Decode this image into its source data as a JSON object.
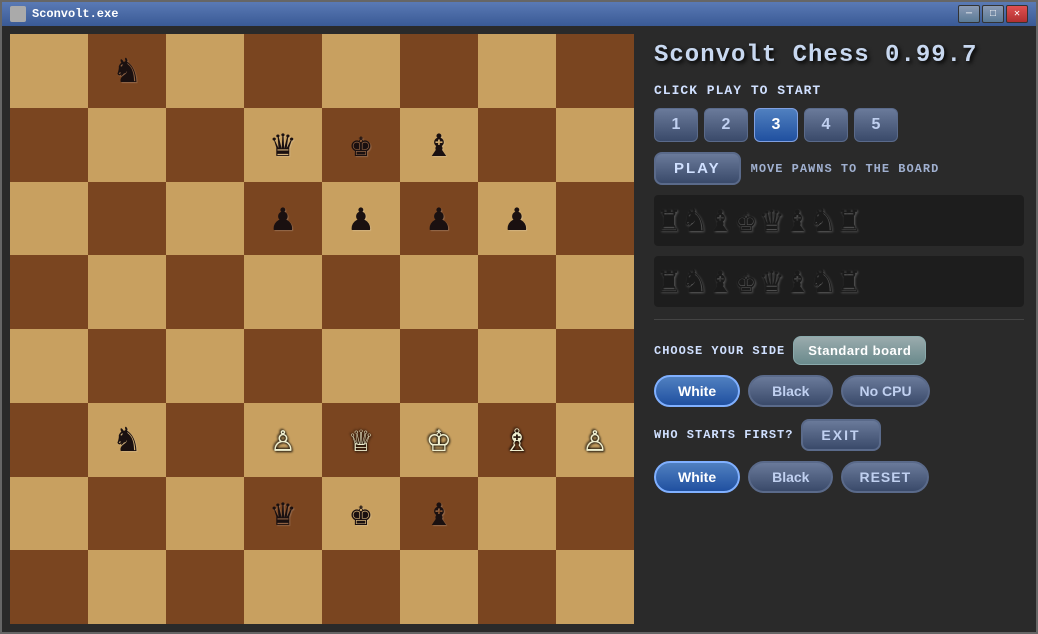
{
  "window": {
    "title": "Sconvolt.exe"
  },
  "app": {
    "title": "Sconvolt Chess 0.99.7",
    "click_to_start": "CLICK PLAY TO START",
    "play_label": "PLAY",
    "play_instruction": "MOVE PAWNS TO THE BOARD",
    "choose_side_label": "CHOOSE YOUR SIDE",
    "standard_board_label": "Standard board",
    "white_label": "White",
    "black_label": "Black",
    "no_cpu_label": "No CPU",
    "who_starts_label": "WHO STARTS FIRST?",
    "exit_label": "EXIT",
    "reset_label": "RESET"
  },
  "difficulty": {
    "levels": [
      "1",
      "2",
      "3",
      "4",
      "5"
    ],
    "active": 2
  },
  "board": {
    "pieces": [
      [
        "",
        "♞",
        "",
        "",
        "",
        "",
        "",
        ""
      ],
      [
        "",
        "",
        "",
        "♛",
        "♚",
        "♝",
        "",
        ""
      ],
      [
        "",
        "",
        "",
        "♟",
        "♟",
        "♟",
        "♟",
        ""
      ],
      [
        "",
        "",
        "",
        "",
        "",
        "",
        "",
        ""
      ],
      [
        "",
        "",
        "",
        "",
        "",
        "",
        "",
        ""
      ],
      [
        "",
        "♞",
        "",
        "♙",
        "♕",
        "♔",
        "♗",
        "♙"
      ],
      [
        "",
        "",
        "",
        "♛",
        "♚",
        "♝",
        "",
        ""
      ],
      [
        "",
        "",
        "",
        "",
        "",
        "",
        "",
        ""
      ]
    ]
  },
  "icons": {
    "minimize": "─",
    "maximize": "□",
    "close": "✕"
  }
}
